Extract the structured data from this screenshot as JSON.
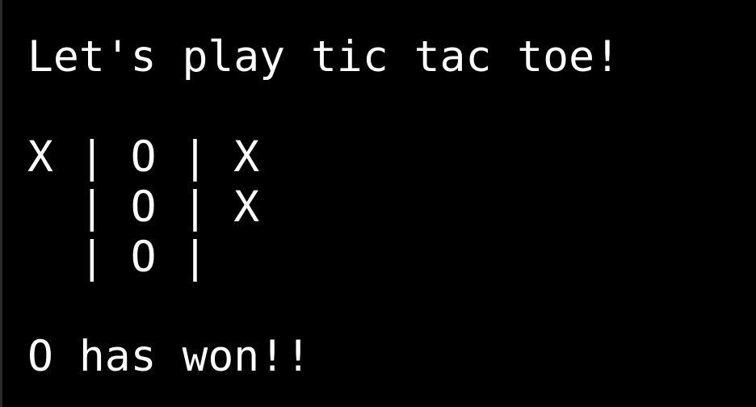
{
  "terminal": {
    "title_line": "Let's play tic tac toe!",
    "board": [
      "X | O | X",
      "  | O | X",
      "  | O |"
    ],
    "result_line": "O has won!!",
    "colors": {
      "background": "#000000",
      "text": "#ffffff"
    }
  }
}
